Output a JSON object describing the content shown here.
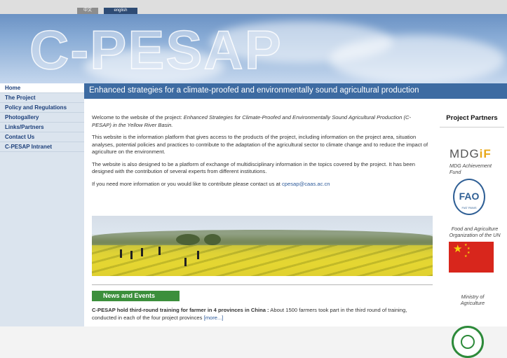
{
  "top_bar": {
    "lang_zh": "中文",
    "lang_en": "english"
  },
  "banner": {
    "logo_text": "C-PESAP"
  },
  "sidebar": {
    "items": [
      {
        "label": "Home",
        "active": true
      },
      {
        "label": "The Project"
      },
      {
        "label": "Policy and Regulations"
      },
      {
        "label": "Photogallery"
      },
      {
        "label": "Links/Partners"
      },
      {
        "label": "Contact Us"
      },
      {
        "label": "C-PESAP Intranet"
      }
    ]
  },
  "header": {
    "title": "Enhanced strategies for a climate-proofed and environmentally sound agricultural production"
  },
  "main": {
    "welcome_prefix": "Welcome to the website of the project: ",
    "welcome_italic": "Enhanced Strategies for Climate-Proofed and Environmentally Sound Agricultural Production (C-PESAP) in the Yellow River Basin.",
    "paragraph2": "This website is the information platform that gives access to the products of the project, including information on the project area, situation analyses, potential policies and practices to contribute to the adaptation of the agricultural sector to climate change and to reduce the impact of agriculture on the environment.",
    "paragraph3": "The website is also designed to be a platform of exchange of multidisciplinary information in the topics covered by the project. It has been designed with the contribution of several experts from different institutions.",
    "contact_prefix": "If you need more information or you would like to contribute please contact us at ",
    "contact_email": "cpesap@caas.ac.cn"
  },
  "news": {
    "heading": "News and Events",
    "item_title": "C-PESAP hold third-round training for farmer in 4 provinces in China :",
    "item_text": " About 1500 farmers took part in the third round of training, conducted in each of the four project provinces ",
    "more_link": "[more...]"
  },
  "partners": {
    "heading": "Project Partners",
    "mdg_logo_main": "MDG",
    "mdg_logo_i": "i",
    "mdg_logo_f": "F",
    "mdg_caption": "MDG Achievement Fund",
    "fao_logo_text": "FAO",
    "fao_logo_motto": "FIAT PANIS",
    "fao_caption": "Food and Agriculture Organization of the UN",
    "ministry_caption": "Ministry of Agriculture"
  },
  "colors": {
    "sidebar_bg": "#dbe4ee",
    "nav_text": "#1c3f7a",
    "title_bar": "#3d6ba2",
    "news_heading_bg": "#3c8f3c",
    "link": "#2e5b9a",
    "mdg_accent": "#e8a818"
  }
}
